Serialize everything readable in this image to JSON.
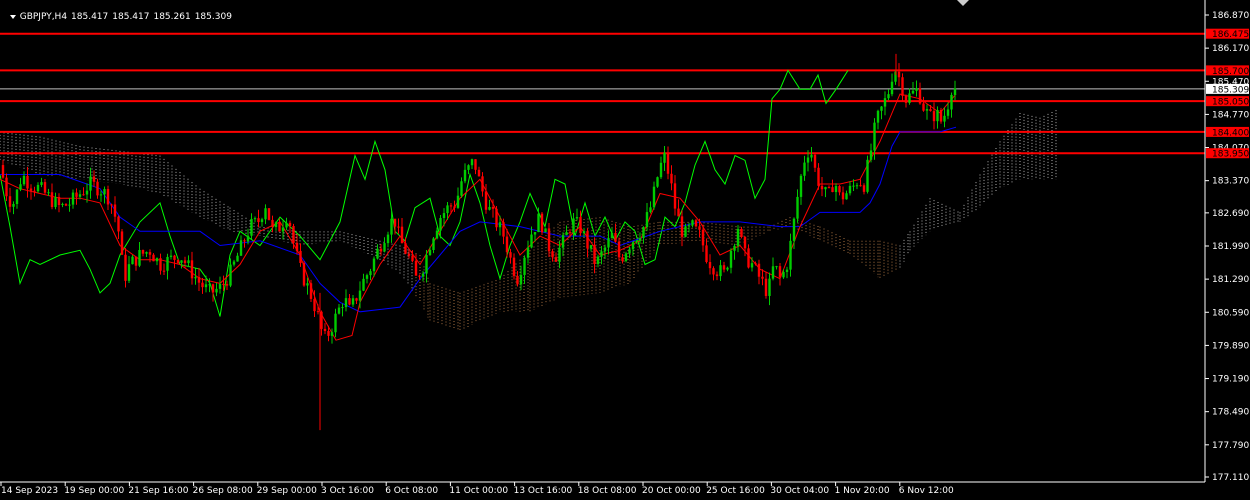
{
  "header": {
    "symbol_tf": "GBPJPY,H4",
    "ohlc": [
      "185.417",
      "185.417",
      "185.261",
      "185.309"
    ]
  },
  "colors": {
    "background": "#000000",
    "axis": "#ffffff",
    "bull": "#00cc00",
    "bear": "#ff0000",
    "tenkan": "#ff0000",
    "kijun": "#0000ff",
    "chikou": "#00ff00",
    "cloud_bear": "#ffffff",
    "cloud_bull": "#f4a460",
    "hline": "#ff0000",
    "hline_label_bg": "#ff0000",
    "current_bg": "#ffffff"
  },
  "chart_data": {
    "type": "candlestick",
    "symbol": "GBPJPY",
    "timeframe": "H4",
    "ylim": [
      177.11,
      187.2
    ],
    "y_ticks": [
      "186.870",
      "186.170",
      "185.470",
      "184.770",
      "184.070",
      "183.370",
      "182.690",
      "181.990",
      "181.290",
      "180.590",
      "179.890",
      "179.190",
      "178.490",
      "177.790",
      "177.110"
    ],
    "x_ticks": [
      "14 Sep 2023",
      "19 Sep 00:00",
      "21 Sep 16:00",
      "26 Sep 08:00",
      "29 Sep 00:00",
      "3 Oct 16:00",
      "6 Oct 08:00",
      "11 Oct 00:00",
      "13 Oct 16:00",
      "18 Oct 08:00",
      "20 Oct 00:00",
      "25 Oct 16:00",
      "30 Oct 04:00",
      "1 Nov 20:00",
      "6 Nov 12:00"
    ],
    "horizontal_levels": [
      {
        "value": 186.475,
        "label": "186.475"
      },
      {
        "value": 185.7,
        "label": "185.700"
      },
      {
        "value": 185.05,
        "label": "185.050"
      },
      {
        "value": 184.4,
        "label": "184.400"
      },
      {
        "value": 183.95,
        "label": "183.950"
      }
    ],
    "current_price": {
      "value": 185.309,
      "label": "185.309"
    },
    "close_path": [
      [
        0,
        183.7
      ],
      [
        8,
        183.0
      ],
      [
        14,
        182.9
      ],
      [
        22,
        183.5
      ],
      [
        30,
        183.3
      ],
      [
        40,
        183.2
      ],
      [
        50,
        183.0
      ],
      [
        60,
        182.8
      ],
      [
        70,
        182.9
      ],
      [
        80,
        183.1
      ],
      [
        90,
        183.3
      ],
      [
        100,
        183.2
      ],
      [
        110,
        183.0
      ],
      [
        118,
        182.4
      ],
      [
        124,
        181.3
      ],
      [
        130,
        181.6
      ],
      [
        140,
        181.8
      ],
      [
        150,
        181.9
      ],
      [
        160,
        181.6
      ],
      [
        170,
        181.7
      ],
      [
        180,
        181.8
      ],
      [
        190,
        181.5
      ],
      [
        200,
        181.2
      ],
      [
        210,
        181.0
      ],
      [
        220,
        181.1
      ],
      [
        230,
        181.4
      ],
      [
        240,
        181.9
      ],
      [
        250,
        182.4
      ],
      [
        258,
        182.5
      ],
      [
        266,
        182.9
      ],
      [
        272,
        182.3
      ],
      [
        280,
        182.4
      ],
      [
        288,
        182.7
      ],
      [
        294,
        182.0
      ],
      [
        300,
        181.5
      ],
      [
        306,
        181.2
      ],
      [
        312,
        180.9
      ],
      [
        318,
        180.5
      ],
      [
        324,
        180.0
      ],
      [
        330,
        180.2
      ],
      [
        338,
        180.6
      ],
      [
        344,
        180.9
      ],
      [
        350,
        180.6
      ],
      [
        356,
        180.9
      ],
      [
        362,
        181.2
      ],
      [
        370,
        181.5
      ],
      [
        378,
        181.9
      ],
      [
        386,
        182.3
      ],
      [
        394,
        182.6
      ],
      [
        400,
        182.1
      ],
      [
        408,
        181.8
      ],
      [
        416,
        181.3
      ],
      [
        424,
        181.6
      ],
      [
        432,
        182.2
      ],
      [
        440,
        182.6
      ],
      [
        448,
        182.8
      ],
      [
        456,
        182.9
      ],
      [
        462,
        183.4
      ],
      [
        468,
        183.6
      ],
      [
        474,
        183.8
      ],
      [
        480,
        183.3
      ],
      [
        488,
        182.8
      ],
      [
        496,
        182.5
      ],
      [
        504,
        182.2
      ],
      [
        512,
        181.6
      ],
      [
        518,
        181.3
      ],
      [
        524,
        181.8
      ],
      [
        532,
        182.3
      ],
      [
        540,
        182.6
      ],
      [
        548,
        182.0
      ],
      [
        556,
        181.8
      ],
      [
        564,
        182.1
      ],
      [
        572,
        182.5
      ],
      [
        580,
        182.4
      ],
      [
        588,
        182.0
      ],
      [
        596,
        181.6
      ],
      [
        604,
        181.9
      ],
      [
        612,
        182.2
      ],
      [
        620,
        181.7
      ],
      [
        628,
        182.0
      ],
      [
        636,
        182.2
      ],
      [
        644,
        182.4
      ],
      [
        652,
        182.9
      ],
      [
        658,
        183.5
      ],
      [
        664,
        183.9
      ],
      [
        670,
        183.4
      ],
      [
        676,
        182.7
      ],
      [
        684,
        182.2
      ],
      [
        692,
        182.4
      ],
      [
        700,
        182.2
      ],
      [
        708,
        181.7
      ],
      [
        716,
        181.5
      ],
      [
        724,
        181.4
      ],
      [
        732,
        182.0
      ],
      [
        738,
        182.4
      ],
      [
        744,
        181.8
      ],
      [
        752,
        181.6
      ],
      [
        760,
        181.3
      ],
      [
        768,
        181.0
      ],
      [
        774,
        181.6
      ],
      [
        780,
        181.3
      ],
      [
        786,
        181.5
      ],
      [
        792,
        182.2
      ],
      [
        798,
        183.1
      ],
      [
        804,
        183.8
      ],
      [
        810,
        184.1
      ],
      [
        816,
        183.5
      ],
      [
        822,
        183.2
      ],
      [
        828,
        183.0
      ],
      [
        834,
        183.4
      ],
      [
        840,
        183.0
      ],
      [
        846,
        183.1
      ],
      [
        852,
        183.2
      ],
      [
        858,
        183.4
      ],
      [
        864,
        183.3
      ],
      [
        870,
        183.9
      ],
      [
        876,
        184.6
      ],
      [
        882,
        184.9
      ],
      [
        888,
        185.2
      ],
      [
        894,
        185.8
      ],
      [
        900,
        185.5
      ],
      [
        906,
        185.1
      ],
      [
        912,
        185.2
      ],
      [
        918,
        185.3
      ],
      [
        924,
        184.9
      ],
      [
        930,
        184.7
      ],
      [
        936,
        184.8
      ],
      [
        942,
        184.6
      ],
      [
        948,
        185.0
      ],
      [
        952,
        185.4
      ],
      [
        956,
        185.3
      ]
    ],
    "tenkan_path": [
      [
        0,
        183.4
      ],
      [
        20,
        183.2
      ],
      [
        40,
        183.1
      ],
      [
        60,
        183.0
      ],
      [
        80,
        183.0
      ],
      [
        100,
        182.9
      ],
      [
        120,
        182.0
      ],
      [
        140,
        181.7
      ],
      [
        160,
        181.7
      ],
      [
        180,
        181.6
      ],
      [
        200,
        181.3
      ],
      [
        220,
        181.2
      ],
      [
        240,
        181.6
      ],
      [
        260,
        182.3
      ],
      [
        280,
        182.5
      ],
      [
        300,
        181.8
      ],
      [
        320,
        180.6
      ],
      [
        336,
        180.0
      ],
      [
        352,
        180.1
      ],
      [
        360,
        180.8
      ],
      [
        380,
        181.6
      ],
      [
        400,
        182.2
      ],
      [
        420,
        181.6
      ],
      [
        440,
        182.3
      ],
      [
        460,
        183.0
      ],
      [
        480,
        183.4
      ],
      [
        500,
        182.6
      ],
      [
        520,
        181.8
      ],
      [
        540,
        182.2
      ],
      [
        560,
        182.0
      ],
      [
        580,
        182.4
      ],
      [
        600,
        181.8
      ],
      [
        620,
        181.9
      ],
      [
        640,
        182.1
      ],
      [
        660,
        183.1
      ],
      [
        680,
        183.0
      ],
      [
        700,
        182.5
      ],
      [
        720,
        181.8
      ],
      [
        740,
        182.0
      ],
      [
        760,
        181.5
      ],
      [
        780,
        181.3
      ],
      [
        800,
        182.4
      ],
      [
        820,
        183.3
      ],
      [
        840,
        183.3
      ],
      [
        860,
        183.4
      ],
      [
        880,
        184.2
      ],
      [
        900,
        185.2
      ],
      [
        920,
        185.1
      ],
      [
        940,
        184.8
      ],
      [
        956,
        185.2
      ]
    ],
    "kijun_path": [
      [
        0,
        183.5
      ],
      [
        60,
        183.5
      ],
      [
        100,
        183.2
      ],
      [
        120,
        182.6
      ],
      [
        140,
        182.3
      ],
      [
        200,
        182.3
      ],
      [
        220,
        182.0
      ],
      [
        260,
        182.1
      ],
      [
        300,
        181.8
      ],
      [
        320,
        181.2
      ],
      [
        340,
        180.8
      ],
      [
        360,
        180.6
      ],
      [
        400,
        180.7
      ],
      [
        420,
        181.3
      ],
      [
        440,
        181.8
      ],
      [
        460,
        182.3
      ],
      [
        480,
        182.5
      ],
      [
        520,
        182.4
      ],
      [
        560,
        182.2
      ],
      [
        600,
        182.2
      ],
      [
        620,
        182.0
      ],
      [
        660,
        182.3
      ],
      [
        700,
        182.5
      ],
      [
        740,
        182.5
      ],
      [
        780,
        182.4
      ],
      [
        800,
        182.4
      ],
      [
        820,
        182.7
      ],
      [
        860,
        182.7
      ],
      [
        870,
        182.9
      ],
      [
        880,
        183.3
      ],
      [
        892,
        184.1
      ],
      [
        900,
        184.4
      ],
      [
        940,
        184.4
      ],
      [
        956,
        184.5
      ]
    ],
    "chikou_path": [
      [
        0,
        183.5
      ],
      [
        10,
        182.4
      ],
      [
        20,
        181.2
      ],
      [
        30,
        181.7
      ],
      [
        40,
        181.6
      ],
      [
        60,
        181.8
      ],
      [
        80,
        181.9
      ],
      [
        90,
        181.5
      ],
      [
        100,
        181.0
      ],
      [
        110,
        181.2
      ],
      [
        120,
        181.8
      ],
      [
        140,
        182.5
      ],
      [
        160,
        182.9
      ],
      [
        170,
        182.2
      ],
      [
        180,
        181.6
      ],
      [
        200,
        181.5
      ],
      [
        210,
        181.2
      ],
      [
        220,
        180.5
      ],
      [
        230,
        181.8
      ],
      [
        240,
        182.3
      ],
      [
        260,
        182.0
      ],
      [
        280,
        182.6
      ],
      [
        300,
        182.2
      ],
      [
        320,
        181.7
      ],
      [
        340,
        182.5
      ],
      [
        355,
        183.9
      ],
      [
        365,
        183.4
      ],
      [
        375,
        184.2
      ],
      [
        385,
        183.6
      ],
      [
        395,
        182.3
      ],
      [
        405,
        182.1
      ],
      [
        415,
        182.8
      ],
      [
        430,
        183.0
      ],
      [
        440,
        182.2
      ],
      [
        450,
        182.0
      ],
      [
        460,
        182.5
      ],
      [
        470,
        183.5
      ],
      [
        480,
        182.9
      ],
      [
        490,
        182.0
      ],
      [
        500,
        181.3
      ],
      [
        510,
        182.0
      ],
      [
        520,
        182.5
      ],
      [
        530,
        183.1
      ],
      [
        545,
        182.4
      ],
      [
        555,
        183.4
      ],
      [
        565,
        183.3
      ],
      [
        575,
        182.2
      ],
      [
        585,
        182.9
      ],
      [
        595,
        182.2
      ],
      [
        605,
        182.6
      ],
      [
        615,
        182.1
      ],
      [
        625,
        182.5
      ],
      [
        635,
        182.3
      ],
      [
        645,
        181.6
      ],
      [
        655,
        181.7
      ],
      [
        665,
        182.6
      ],
      [
        675,
        182.4
      ],
      [
        685,
        182.9
      ],
      [
        695,
        183.7
      ],
      [
        705,
        184.2
      ],
      [
        715,
        183.6
      ],
      [
        725,
        183.3
      ],
      [
        735,
        183.9
      ],
      [
        745,
        183.8
      ],
      [
        755,
        183.0
      ],
      [
        765,
        183.4
      ],
      [
        772,
        185.1
      ],
      [
        780,
        185.3
      ],
      [
        788,
        185.7
      ],
      [
        800,
        185.3
      ],
      [
        810,
        185.3
      ],
      [
        818,
        185.6
      ],
      [
        826,
        185.0
      ],
      [
        836,
        185.3
      ],
      [
        848,
        185.7
      ]
    ],
    "cloud": [
      [
        0,
        184.4,
        183.8
      ],
      [
        40,
        184.3,
        183.5
      ],
      [
        80,
        184.1,
        183.4
      ],
      [
        120,
        184.0,
        183.3
      ],
      [
        160,
        183.9,
        183.1
      ],
      [
        200,
        183.2,
        182.6
      ],
      [
        230,
        182.8,
        182.3
      ],
      [
        260,
        182.4,
        182.2
      ],
      [
        300,
        182.3,
        182.0
      ],
      [
        340,
        182.3,
        182.1
      ],
      [
        380,
        182.1,
        181.7
      ],
      [
        400,
        182.0,
        181.4
      ],
      [
        420,
        181.8,
        180.8
      ],
      [
        430,
        181.2,
        180.4
      ],
      [
        460,
        181.0,
        180.2
      ],
      [
        500,
        181.3,
        180.6
      ],
      [
        530,
        181.9,
        180.6
      ],
      [
        560,
        182.5,
        180.9
      ],
      [
        600,
        182.6,
        181.0
      ],
      [
        630,
        182.4,
        181.2
      ],
      [
        660,
        182.5,
        182.0
      ],
      [
        700,
        182.5,
        182.1
      ],
      [
        740,
        182.4,
        182.0
      ],
      [
        770,
        182.4,
        182.3
      ],
      [
        790,
        182.6,
        182.4
      ],
      [
        820,
        182.4,
        182.1
      ],
      [
        850,
        182.1,
        181.8
      ],
      [
        880,
        182.1,
        181.3
      ],
      [
        900,
        182.0,
        181.5
      ],
      [
        910,
        182.3,
        181.9
      ],
      [
        930,
        183.0,
        182.3
      ],
      [
        960,
        182.7,
        182.5
      ],
      [
        980,
        183.5,
        182.8
      ],
      [
        1000,
        184.2,
        183.2
      ],
      [
        1020,
        184.8,
        183.4
      ],
      [
        1040,
        184.7,
        183.4
      ],
      [
        1060,
        184.9,
        183.4
      ]
    ]
  }
}
